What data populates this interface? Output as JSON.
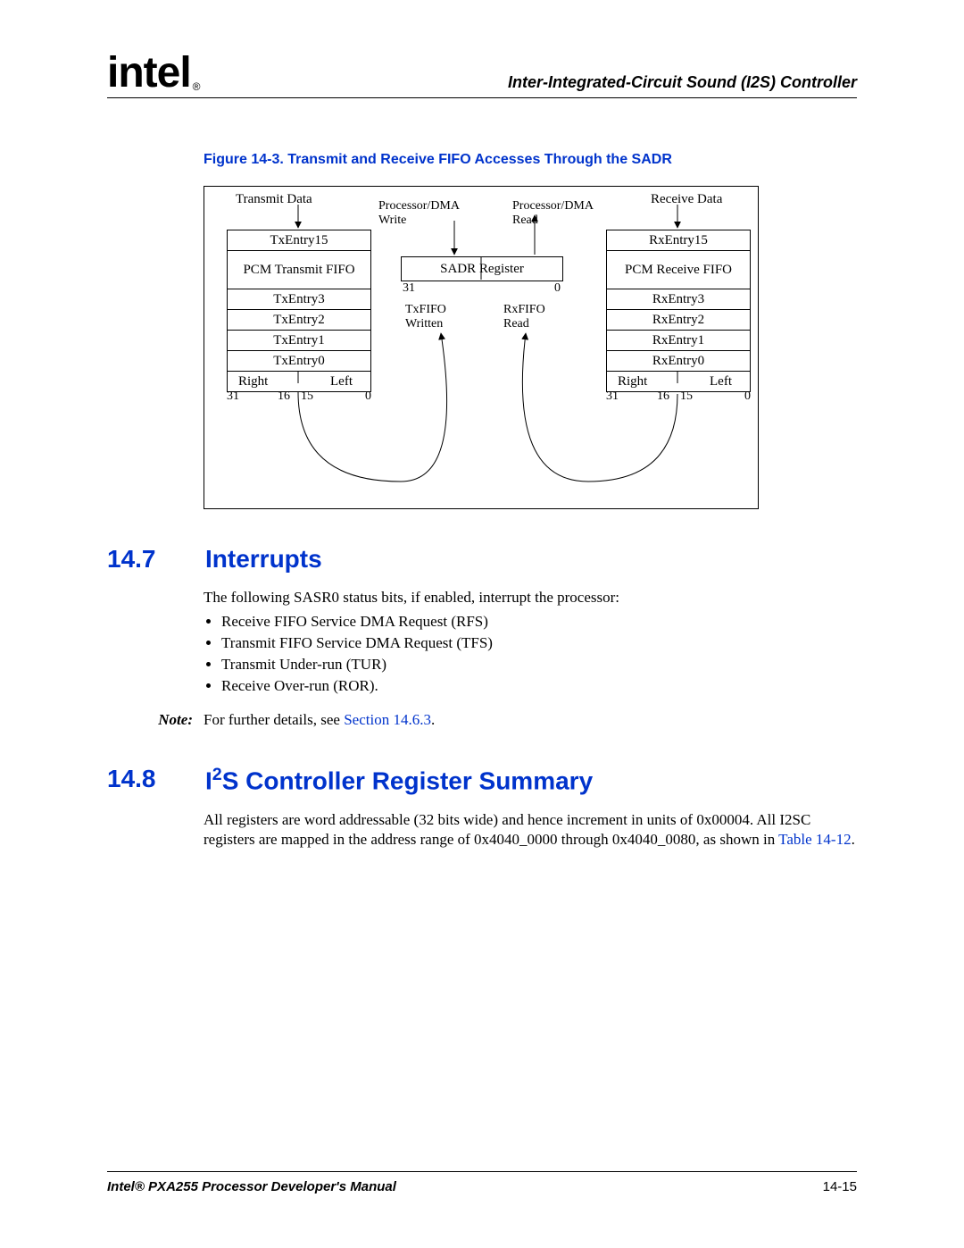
{
  "header": {
    "logo_text": "intel",
    "logo_reg": "®",
    "chapter_title": "Inter-Integrated-Circuit Sound (I2S) Controller"
  },
  "figure": {
    "title": "Figure 14-3. Transmit and Receive FIFO Accesses Through the SADR",
    "tx_header": "Transmit Data",
    "rx_header": "Receive Data",
    "proc_write": "Processor/DMA\nWrite",
    "proc_read": "Processor/DMA\nRead",
    "sadr": "SADR Register",
    "sadr_left": "31",
    "sadr_right": "0",
    "txfifo_written": "TxFIFO\nWritten",
    "rxfifo_read": "RxFIFO\nRead",
    "pcm_tx": "PCM Transmit FIFO",
    "pcm_rx": "PCM Receive FIFO",
    "tx_entries": [
      "TxEntry15",
      "TxEntry3",
      "TxEntry2",
      "TxEntry1",
      "TxEntry0"
    ],
    "rx_entries": [
      "RxEntry15",
      "RxEntry3",
      "RxEntry2",
      "RxEntry1",
      "RxEntry0"
    ],
    "right_label": "Right",
    "left_label": "Left",
    "bits31": "31",
    "bits16": "16",
    "bits15": "15",
    "bits0": "0"
  },
  "section147": {
    "num": "14.7",
    "title": "Interrupts",
    "intro": "The following SASR0 status bits, if enabled, interrupt the processor:",
    "bullets": [
      "Receive FIFO Service DMA Request (RFS)",
      "Transmit FIFO Service DMA Request (TFS)",
      "Transmit Under-run (TUR)",
      "Receive Over-run (ROR)."
    ],
    "note_label": "Note:",
    "note_text": "For further details, see ",
    "note_link": "Section 14.6.3",
    "note_tail": "."
  },
  "section148": {
    "num": "14.8",
    "title_pre": "I",
    "title_sup": "2",
    "title_post": "S Controller Register Summary",
    "body_pre": "All registers are word addressable (32 bits wide) and hence increment in units of 0x00004. All I2SC registers are mapped in the address range of 0x4040_0000 through 0x4040_0080, as shown in ",
    "body_link": "Table 14-12",
    "body_tail": "."
  },
  "footer": {
    "left": "Intel® PXA255 Processor Developer's Manual",
    "right": "14-15"
  }
}
